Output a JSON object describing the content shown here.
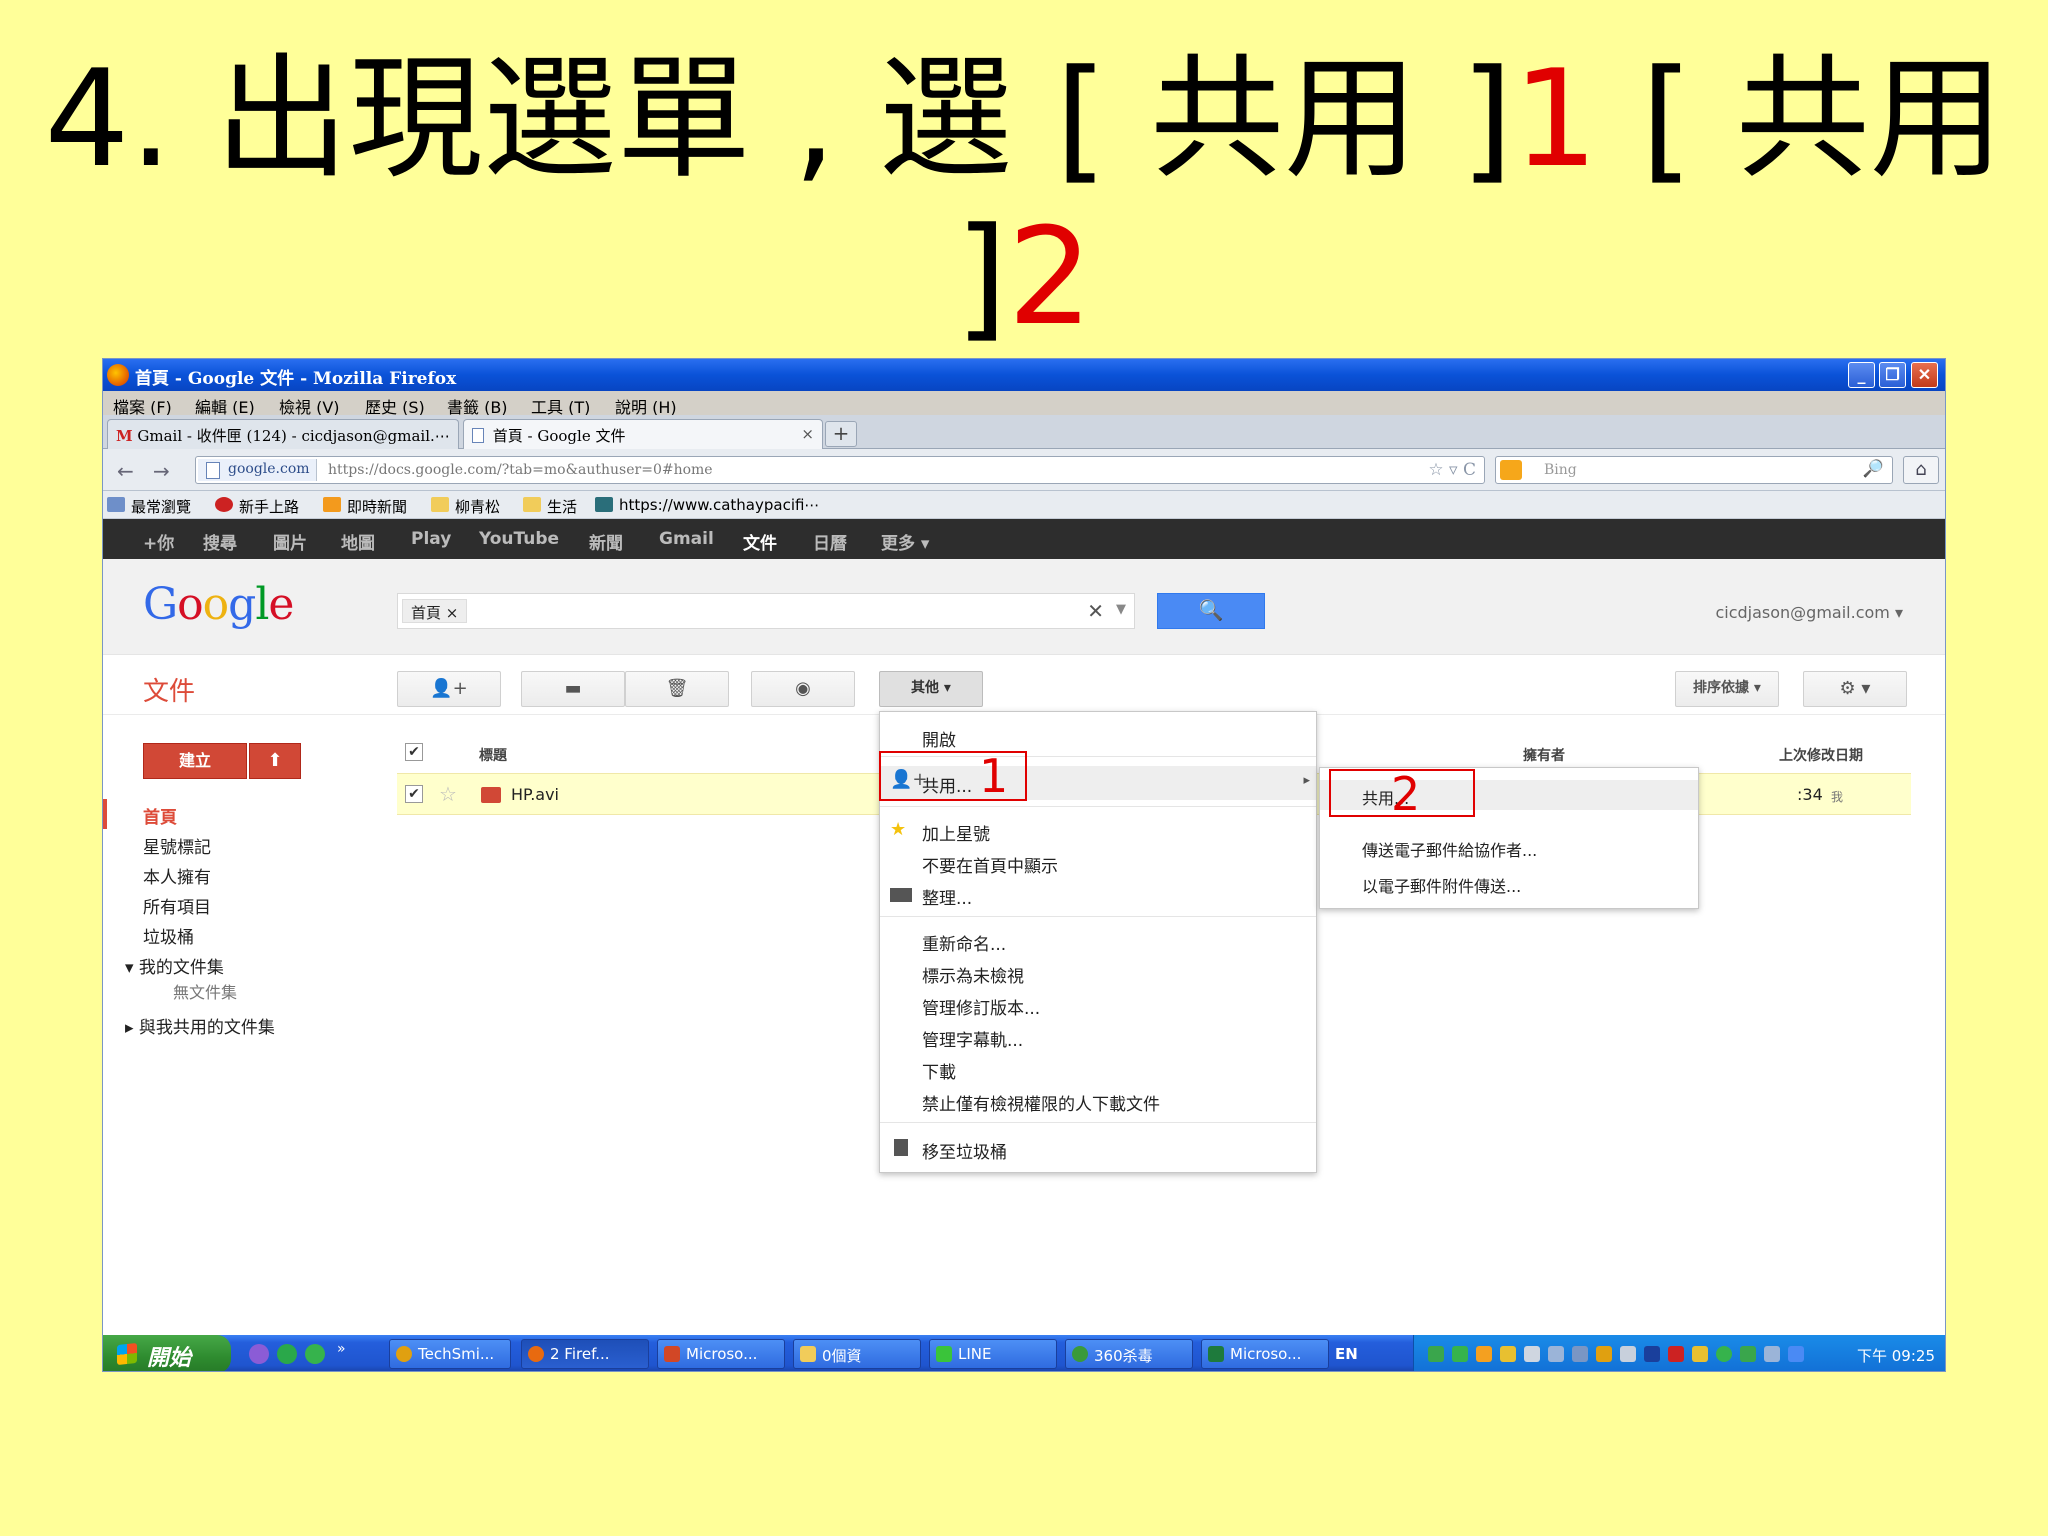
{
  "slide": {
    "title_part1": "4. 出現選單 , 選 [ 共用 ]",
    "title_num1": "1",
    "title_part2": " [ 共用 ]",
    "title_num2": "2"
  },
  "window": {
    "title": "首頁 - Google 文件 - Mozilla Firefox",
    "minimize": "_",
    "maximize": "❐",
    "close": "✕"
  },
  "menubar": [
    "檔案 (F)",
    "編輯 (E)",
    "檢視 (V)",
    "歷史 (S)",
    "書籤 (B)",
    "工具 (T)",
    "說明 (H)"
  ],
  "tabs": [
    {
      "label": "Gmail - 收件匣 (124) - cicdjason@gmail.⋯",
      "close": "×"
    },
    {
      "label": "首頁 - Google 文件",
      "close": "×"
    }
  ],
  "new_tab": "+",
  "nav": {
    "back": "←",
    "forward": "→",
    "site": "google.com",
    "url": "https://docs.google.com/?tab=mo&authuser=0#home",
    "url_controls": "☆ ▿ C",
    "search_placeholder": "Bing",
    "search_icon": "🔎",
    "home": "⌂"
  },
  "bookmarks": [
    {
      "label": "最常瀏覽",
      "color": "#6e8fc9"
    },
    {
      "label": "新手上路",
      "color": "#c22"
    },
    {
      "label": "即時新聞",
      "color": "#f39a1d"
    },
    {
      "label": "柳青松",
      "color": "#f1cc5a"
    },
    {
      "label": "生活",
      "color": "#f1cc5a"
    },
    {
      "label": "https://www.cathaypacifi⋯",
      "color": "#2a6e7a"
    }
  ],
  "gbar": [
    "+你",
    "搜尋",
    "圖片",
    "地圖",
    "Play",
    "YouTube",
    "新聞",
    "Gmail",
    "文件",
    "日曆",
    "更多 ▾"
  ],
  "gbar_active": "文件",
  "google": {
    "logo": [
      "G",
      "o",
      "o",
      "g",
      "l",
      "e"
    ],
    "logo_colors": [
      "#3369e8",
      "#d50f25",
      "#eeb211",
      "#3369e8",
      "#009925",
      "#d50f25"
    ],
    "search_chip": "首頁 ×",
    "search_clear": "✕",
    "search_dropdown": "▼",
    "search_button": "🔍",
    "account": "cicdjason@gmail.com ▾"
  },
  "docs": {
    "title": "文件",
    "toolbar_share": "👤+",
    "toolbar_folder": "▬",
    "toolbar_trash": "🗑",
    "toolbar_preview": "◉",
    "toolbar_more": "其他 ▾",
    "sort": "排序依據 ▾",
    "settings": "⚙ ▾"
  },
  "sidebar": {
    "create": "建立",
    "upload": "⬆",
    "items": [
      "首頁",
      "星號標記",
      "本人擁有",
      "所有項目",
      "垃圾桶"
    ],
    "my_collections": "▾ 我的文件集",
    "no_collections": "無文件集",
    "shared_collections": "▸ 與我共用的文件集"
  },
  "list": {
    "check_all": "✔",
    "col_title": "標題",
    "col_owner": "擁有者",
    "col_modified": "上次修改日期",
    "row": {
      "check": "✔",
      "star": "☆",
      "name": "HP.avi",
      "modified": ":34",
      "modified_suffix": "我"
    }
  },
  "context_menu": {
    "open": "開啟",
    "share": "共用...",
    "star": "加上星號",
    "hide": "不要在首頁中顯示",
    "organize": "整理...",
    "rename": "重新命名...",
    "mark_unviewed": "標示為未檢視",
    "revisions": "管理修訂版本...",
    "captions": "管理字幕軌...",
    "download": "下載",
    "prevent_download": "禁止僅有檢視權限的人下載文件",
    "trash": "移至垃圾桶",
    "submenu_arrow": "▸"
  },
  "submenu": {
    "share": "共用...",
    "email_collaborators": "傳送電子郵件給協作者...",
    "email_attachment": "以電子郵件附件傳送..."
  },
  "annotations": {
    "one": "1",
    "two": "2"
  },
  "taskbar": {
    "start": "開始",
    "expand": "»",
    "tasks": [
      "TechSmi...",
      "2 Firef...",
      "Microso...",
      "0個資",
      "LINE",
      "360杀毒",
      "Microso..."
    ],
    "lang": "EN",
    "clock": "下午 09:25"
  }
}
